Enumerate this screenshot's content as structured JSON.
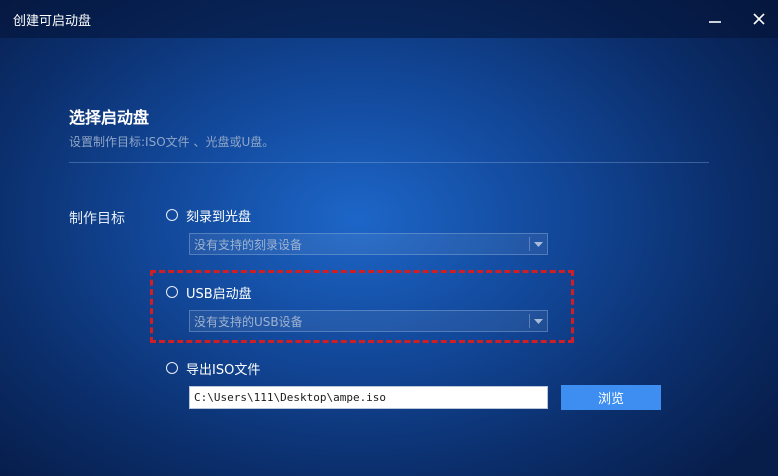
{
  "window": {
    "title": "创建可启动盘",
    "minimize_icon": "minimize-icon",
    "close_icon": "close-icon"
  },
  "main": {
    "heading": "选择启动盘",
    "subheading": "设置制作目标:ISO文件 、光盘或U盘。",
    "section_label": "制作目标",
    "options": [
      {
        "label": "刻录到光盘",
        "selected": false,
        "dropdown_value": "没有支持的刻录设备"
      },
      {
        "label": "USB启动盘",
        "selected": false,
        "highlighted": true,
        "dropdown_value": "没有支持的USB设备"
      },
      {
        "label": "导出ISO文件",
        "selected": false,
        "path_value": "C:\\Users\\111\\Desktop\\ampe.iso",
        "browse_label": "浏览"
      }
    ]
  },
  "colors": {
    "accent": "#3d8ef0",
    "highlight": "#d01f24",
    "background": "#12489a"
  }
}
